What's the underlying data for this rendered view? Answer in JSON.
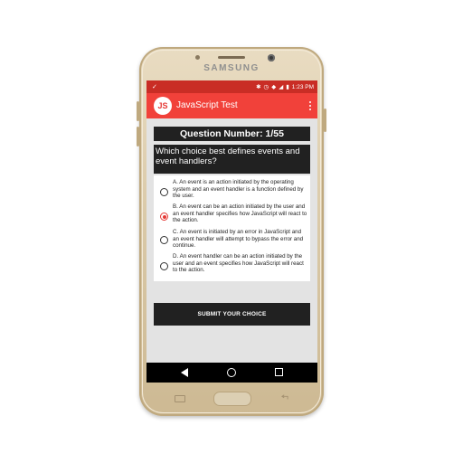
{
  "device": {
    "brand": "SAMSUNG"
  },
  "statusbar": {
    "time": "1:23 PM",
    "battery": "▮"
  },
  "appbar": {
    "logo_text": "JS",
    "title": "JavaScript Test"
  },
  "question": {
    "number_label": "Question Number: 1/55",
    "text": "Which choice best defines events and event handlers?"
  },
  "options": [
    {
      "text": "A. An event is an action initiated by the operating system and an event handler is a function defined by the user.",
      "selected": false
    },
    {
      "text": "B. An event can be an action initiated by the user and an event handler specifies how JavaScript will react to the action.",
      "selected": true
    },
    {
      "text": "C. An event is initiated by an error in JavaScript and an event handler will attempt to bypass the error and continue.",
      "selected": false
    },
    {
      "text": "D. An event handler can be an action initiated by the user and an event specifies how JavaScript will react to the action.",
      "selected": false
    }
  ],
  "submit": {
    "label": "SUBMIT YOUR CHOICE"
  },
  "colors": {
    "accent": "#f1413a",
    "statusbar": "#c92d25",
    "dark": "#212121",
    "phone": "#d9c8a6"
  }
}
